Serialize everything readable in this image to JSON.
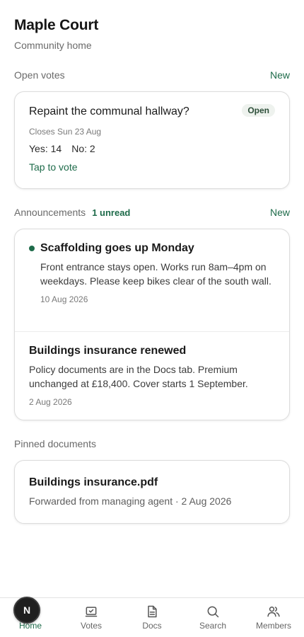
{
  "header": {
    "title": "Maple Court",
    "subtitle": "Community home"
  },
  "votes_section": {
    "label": "Open votes",
    "action": "New"
  },
  "vote": {
    "title": "Repaint the communal hallway?",
    "status": "Open",
    "closes": "Closes Sun 23 Aug",
    "yes": "Yes: 14",
    "no": "No: 2",
    "cta": "Tap to vote"
  },
  "announcements_section": {
    "label": "Announcements",
    "badge": "1 unread",
    "action": "New"
  },
  "announcements": [
    {
      "title": "Scaffolding goes up Monday",
      "body": "Front entrance stays open. Works run 8am–4pm on weekdays. Please keep bikes clear of the south wall.",
      "date": "10 Aug 2026"
    },
    {
      "title": "Buildings insurance renewed",
      "body": "Policy documents are in the Docs tab. Premium unchanged at £18,400. Cover starts 1 September.",
      "date": "2 Aug 2026"
    }
  ],
  "docs_section": {
    "label": "Pinned documents"
  },
  "pinned_doc": {
    "title": "Buildings insurance.pdf",
    "meta": "Forwarded from managing agent · 2 Aug 2026"
  },
  "avatar": {
    "initial": "N"
  },
  "tabs": [
    {
      "label": "Home",
      "icon": "home-icon"
    },
    {
      "label": "Votes",
      "icon": "ballot-check-icon"
    },
    {
      "label": "Docs",
      "icon": "document-icon"
    },
    {
      "label": "Search",
      "icon": "search-icon"
    },
    {
      "label": "Members",
      "icon": "members-icon"
    }
  ],
  "colors": {
    "accent": "#1e6b4a",
    "muted_text": "#6a6a6a",
    "border": "#dcdcdc"
  }
}
